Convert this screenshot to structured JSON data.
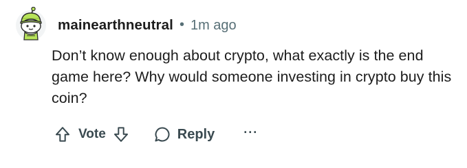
{
  "comment": {
    "author": "mainearthneutral",
    "separator": "•",
    "timestamp": "1m ago",
    "body": "Don’t know enough about crypto, what exactly is the end game here? Why would someone investing in crypto buy this coin?",
    "avatar_icon": "snoo-avatar-icon"
  },
  "actions": {
    "upvote_icon": "upvote-arrow-icon",
    "vote_label": "Vote",
    "downvote_icon": "downvote-arrow-icon",
    "reply_icon": "speech-bubble-icon",
    "reply_label": "Reply",
    "more_label": "···",
    "more_icon": "ellipsis-icon"
  },
  "colors": {
    "avatar_green": "#b7e35a",
    "avatar_outline": "#2b2b2b",
    "text_primary": "#1c1c1c",
    "text_secondary": "#576f76",
    "action_color": "#3a4a50"
  }
}
